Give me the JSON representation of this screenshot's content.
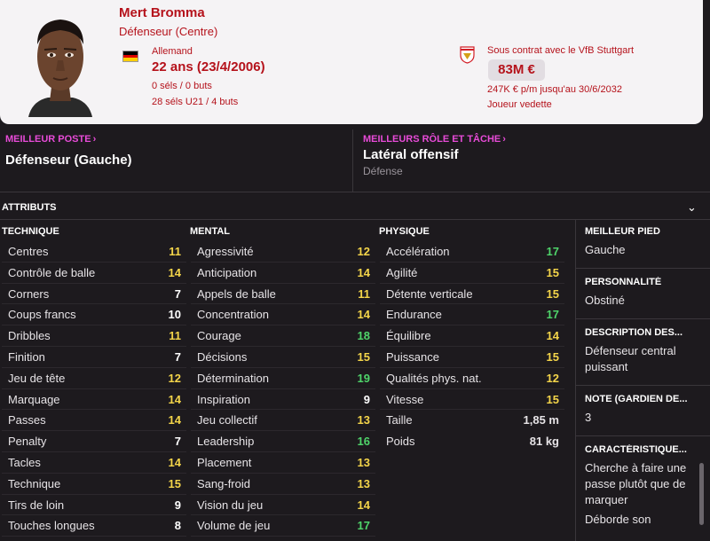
{
  "header": {
    "name": "Mert Bromma",
    "position": "Défenseur (Centre)",
    "nationality": "Allemand",
    "age": "22 ans (23/4/2006)",
    "caps_senior": "0 séls / 0 buts",
    "caps_u21": "28 séls U21 / 4 buts",
    "contract_label": "Sous contrat avec le VfB Stuttgart",
    "value": "83M €",
    "wage": "247K € p/m jusqu'au 30/6/2032",
    "status": "Joueur vedette",
    "flag_colors": [
      "#000000",
      "#dd0000",
      "#ffce00"
    ]
  },
  "best": {
    "position_title": "MEILLEUR POSTE",
    "position_value": "Défenseur (Gauche)",
    "role_title": "MEILLEURS RÔLE ET TÂCHE",
    "role_value": "Latéral offensif",
    "role_duty": "Défense"
  },
  "attributes": {
    "title": "ATTRIBUTS",
    "technical_title": "TECHNIQUE",
    "technical": [
      {
        "label": "Centres",
        "value": "11"
      },
      {
        "label": "Contrôle de balle",
        "value": "14"
      },
      {
        "label": "Corners",
        "value": "7"
      },
      {
        "label": "Coups francs",
        "value": "10"
      },
      {
        "label": "Dribbles",
        "value": "11"
      },
      {
        "label": "Finition",
        "value": "7"
      },
      {
        "label": "Jeu de tête",
        "value": "12"
      },
      {
        "label": "Marquage",
        "value": "14"
      },
      {
        "label": "Passes",
        "value": "14"
      },
      {
        "label": "Penalty",
        "value": "7"
      },
      {
        "label": "Tacles",
        "value": "14"
      },
      {
        "label": "Technique",
        "value": "15"
      },
      {
        "label": "Tirs de loin",
        "value": "9"
      },
      {
        "label": "Touches longues",
        "value": "8"
      }
    ],
    "mental_title": "MENTAL",
    "mental": [
      {
        "label": "Agressivité",
        "value": "12"
      },
      {
        "label": "Anticipation",
        "value": "14"
      },
      {
        "label": "Appels de balle",
        "value": "11"
      },
      {
        "label": "Concentration",
        "value": "14"
      },
      {
        "label": "Courage",
        "value": "18"
      },
      {
        "label": "Décisions",
        "value": "15"
      },
      {
        "label": "Détermination",
        "value": "19"
      },
      {
        "label": "Inspiration",
        "value": "9"
      },
      {
        "label": "Jeu collectif",
        "value": "13"
      },
      {
        "label": "Leadership",
        "value": "16"
      },
      {
        "label": "Placement",
        "value": "13"
      },
      {
        "label": "Sang-froid",
        "value": "13"
      },
      {
        "label": "Vision du jeu",
        "value": "14"
      },
      {
        "label": "Volume de jeu",
        "value": "17"
      }
    ],
    "physical_title": "PHYSIQUE",
    "physical": [
      {
        "label": "Accélération",
        "value": "17"
      },
      {
        "label": "Agilité",
        "value": "15"
      },
      {
        "label": "Détente verticale",
        "value": "15"
      },
      {
        "label": "Endurance",
        "value": "17"
      },
      {
        "label": "Équilibre",
        "value": "14"
      },
      {
        "label": "Puissance",
        "value": "15"
      },
      {
        "label": "Qualités phys. nat.",
        "value": "12"
      },
      {
        "label": "Vitesse",
        "value": "15"
      }
    ],
    "height_label": "Taille",
    "height_value": "1,85 m",
    "weight_label": "Poids",
    "weight_value": "81 kg"
  },
  "side": {
    "foot_title": "MEILLEUR PIED",
    "foot_value": "Gauche",
    "personality_title": "PERSONNALITÉ",
    "personality_value": "Obstiné",
    "description_title": "DESCRIPTION DES...",
    "description_value": "Défenseur central puissant",
    "gk_title": "NOTE (GARDIEN DE...",
    "gk_value": "3",
    "traits_title": "CARACTÉRISTIQUE...",
    "trait_1": "Cherche à faire une passe plutôt que de marquer",
    "trait_2": "Déborde son"
  },
  "colors": {
    "tier_low": "#ffffff",
    "tier_mid": "#f4d54a",
    "tier_high": "#4fd46a",
    "accent": "#e84bd8",
    "header_text": "#b5121b"
  }
}
